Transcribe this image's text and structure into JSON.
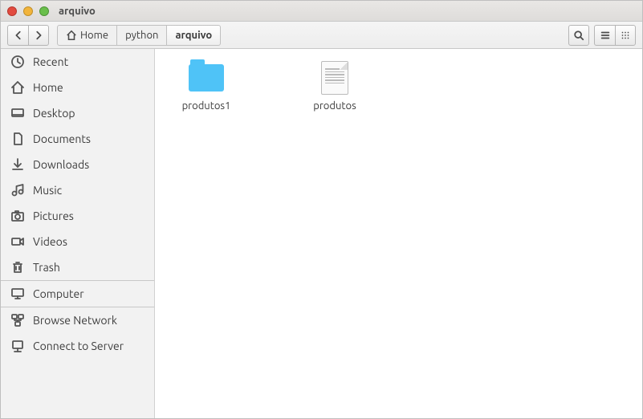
{
  "window": {
    "title": "arquivo"
  },
  "breadcrumb": {
    "home_label": "Home",
    "seg1": "python",
    "seg2": "arquivo"
  },
  "sidebar": {
    "items": [
      {
        "label": "Recent"
      },
      {
        "label": "Home"
      },
      {
        "label": "Desktop"
      },
      {
        "label": "Documents"
      },
      {
        "label": "Downloads"
      },
      {
        "label": "Music"
      },
      {
        "label": "Pictures"
      },
      {
        "label": "Videos"
      },
      {
        "label": "Trash"
      },
      {
        "label": "Computer"
      },
      {
        "label": "Browse Network"
      },
      {
        "label": "Connect to Server"
      }
    ]
  },
  "items": [
    {
      "name": "produtos1",
      "type": "folder"
    },
    {
      "name": "produtos",
      "type": "file"
    }
  ]
}
